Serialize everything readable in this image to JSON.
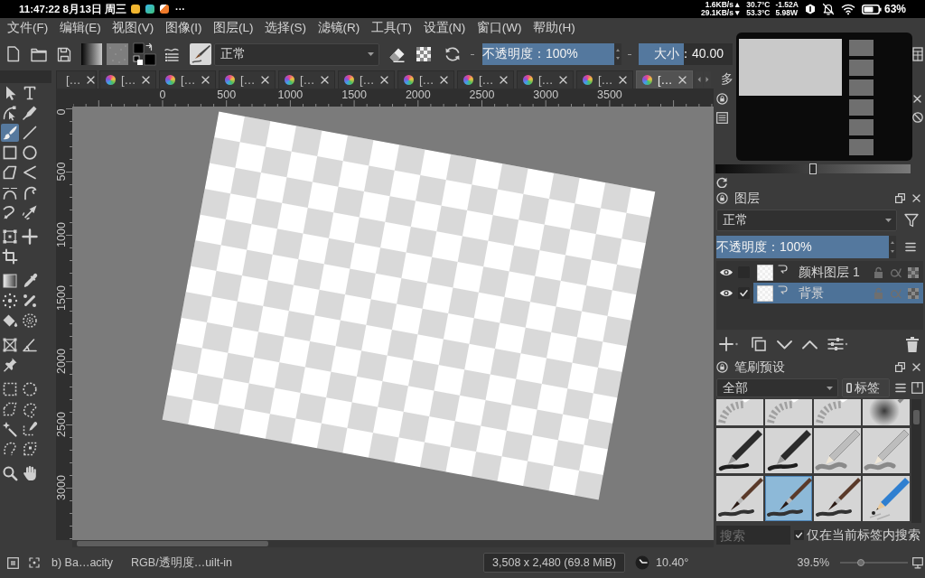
{
  "system_bar": {
    "clock": "11:47:22 8月13日 周三",
    "more": "···",
    "net_up": "1.6KB/s▲",
    "net_down": "29.1KB/s▼",
    "temp_top": "30.7°C",
    "temp_bottom": "53.3°C",
    "current": "-1.52A",
    "power": "5.98W",
    "battery": "63%"
  },
  "menu": [
    "文件(F)",
    "编辑(E)",
    "视图(V)",
    "图像(I)",
    "图层(L)",
    "选择(S)",
    "滤镜(R)",
    "工具(T)",
    "设置(N)",
    "窗口(W)",
    "帮助(H)"
  ],
  "toolbar": {
    "blend_mode": "正常",
    "opacity": {
      "text": "不透明度：100%",
      "level": 1
    },
    "size": {
      "text": "大小：40.00",
      "level": 0.48
    }
  },
  "document_tabs": [
    {
      "label": "[…",
      "icon": false,
      "selected": false
    },
    {
      "label": "[…",
      "icon": true,
      "selected": false
    },
    {
      "label": "[…",
      "icon": true,
      "selected": false
    },
    {
      "label": "[…",
      "icon": true,
      "selected": false
    },
    {
      "label": "[…",
      "icon": true,
      "selected": false
    },
    {
      "label": "[…",
      "icon": true,
      "selected": false
    },
    {
      "label": "[…",
      "icon": true,
      "selected": false
    },
    {
      "label": "[…",
      "icon": true,
      "selected": false
    },
    {
      "label": "[…",
      "icon": true,
      "selected": false
    },
    {
      "label": "[…",
      "icon": true,
      "selected": false
    },
    {
      "label": "[…",
      "icon": true,
      "selected": true
    }
  ],
  "toolbox": [
    {
      "tools": [
        {
          "kind": "select",
          "selected": false
        },
        {
          "kind": "text",
          "selected": false
        },
        {
          "kind": "edit-shape",
          "selected": false
        },
        {
          "kind": "calligraphy",
          "selected": false
        },
        {
          "kind": "brush",
          "selected": true
        },
        {
          "kind": "line",
          "selected": false
        },
        {
          "kind": "rectangle",
          "selected": false
        },
        {
          "kind": "ellipse",
          "selected": false
        },
        {
          "kind": "polygon",
          "selected": false
        },
        {
          "kind": "polyline",
          "selected": false
        },
        {
          "kind": "bezier",
          "selected": false
        },
        {
          "kind": "freehand-path",
          "selected": false
        },
        {
          "kind": "dynamic-brush",
          "selected": false
        },
        {
          "kind": "multibrush",
          "selected": false
        }
      ]
    },
    {
      "tools": [
        {
          "kind": "transform",
          "selected": false
        },
        {
          "kind": "move",
          "selected": false
        },
        {
          "kind": "crop",
          "selected": false
        }
      ]
    },
    {
      "tools": [
        {
          "kind": "gradient",
          "selected": false
        },
        {
          "kind": "color-picker",
          "selected": false
        },
        {
          "kind": "colorize",
          "selected": false
        },
        {
          "kind": "smart-patch",
          "selected": false
        },
        {
          "kind": "fill",
          "selected": false
        },
        {
          "kind": "enclose-fill",
          "selected": false
        }
      ]
    },
    {
      "tools": [
        {
          "kind": "assistant",
          "selected": false
        },
        {
          "kind": "measure",
          "selected": false
        },
        {
          "kind": "reference",
          "selected": false
        }
      ]
    },
    {
      "tools": [
        {
          "kind": "rect-select",
          "selected": false
        },
        {
          "kind": "ellipse-select",
          "selected": false
        },
        {
          "kind": "polygon-select",
          "selected": false
        },
        {
          "kind": "freehand-select",
          "selected": false
        },
        {
          "kind": "contiguous-select",
          "selected": false
        },
        {
          "kind": "similar-select",
          "selected": false
        },
        {
          "kind": "bezier-select",
          "selected": false
        },
        {
          "kind": "magnetic-select",
          "selected": false
        }
      ]
    },
    {
      "tools": [
        {
          "kind": "zoom",
          "selected": false
        },
        {
          "kind": "pan",
          "selected": false
        }
      ]
    }
  ],
  "rulers": {
    "horizontal": [
      "0",
      "500",
      "1000",
      "1500",
      "2000",
      "2500",
      "3000",
      "3500"
    ],
    "vertical": [
      "0",
      "500",
      "1000",
      "1500",
      "2000",
      "2500",
      "3000"
    ]
  },
  "dock_tab": "多",
  "overview": {
    "slider": {
      "level": 0.5
    }
  },
  "layers": {
    "title": "图层",
    "blend_mode": "正常",
    "opacity": {
      "text": "不透明度：100%",
      "level": 1
    },
    "items": [
      {
        "name": "颜料图层 1",
        "visible": true,
        "checked": false,
        "selected": false
      },
      {
        "name": "背景",
        "visible": true,
        "checked": true,
        "selected": true
      }
    ]
  },
  "brush_presets": {
    "title": "笔刷预设",
    "tag": "全部",
    "tag_button": "标签",
    "presets": [
      {
        "kind": "eraser",
        "selected": false
      },
      {
        "kind": "eraser",
        "selected": false
      },
      {
        "kind": "eraser",
        "selected": false
      },
      {
        "kind": "airbrush",
        "selected": false
      },
      {
        "kind": "ink-pen",
        "selected": false
      },
      {
        "kind": "ink-pen",
        "selected": false
      },
      {
        "kind": "pencil",
        "selected": false
      },
      {
        "kind": "pencil",
        "selected": false
      },
      {
        "kind": "paintbrush",
        "selected": false
      },
      {
        "kind": "paintbrush",
        "selected": true
      },
      {
        "kind": "paintbrush",
        "selected": false
      },
      {
        "kind": "color-pencil",
        "selected": false
      }
    ],
    "search": {
      "placeholder": "搜索"
    },
    "search_in_tag": {
      "label": "仅在当前标签内搜索",
      "checked": true
    }
  },
  "status_bar": {
    "brush": "b) Ba…acity",
    "color_space": "RGB/透明度…uilt-in",
    "image_size": "3,508 x 2,480 (69.8 MiB)",
    "rotation": "10.40°",
    "zoom": "39.5%",
    "zoom_slider": {
      "level": 0.31
    }
  }
}
